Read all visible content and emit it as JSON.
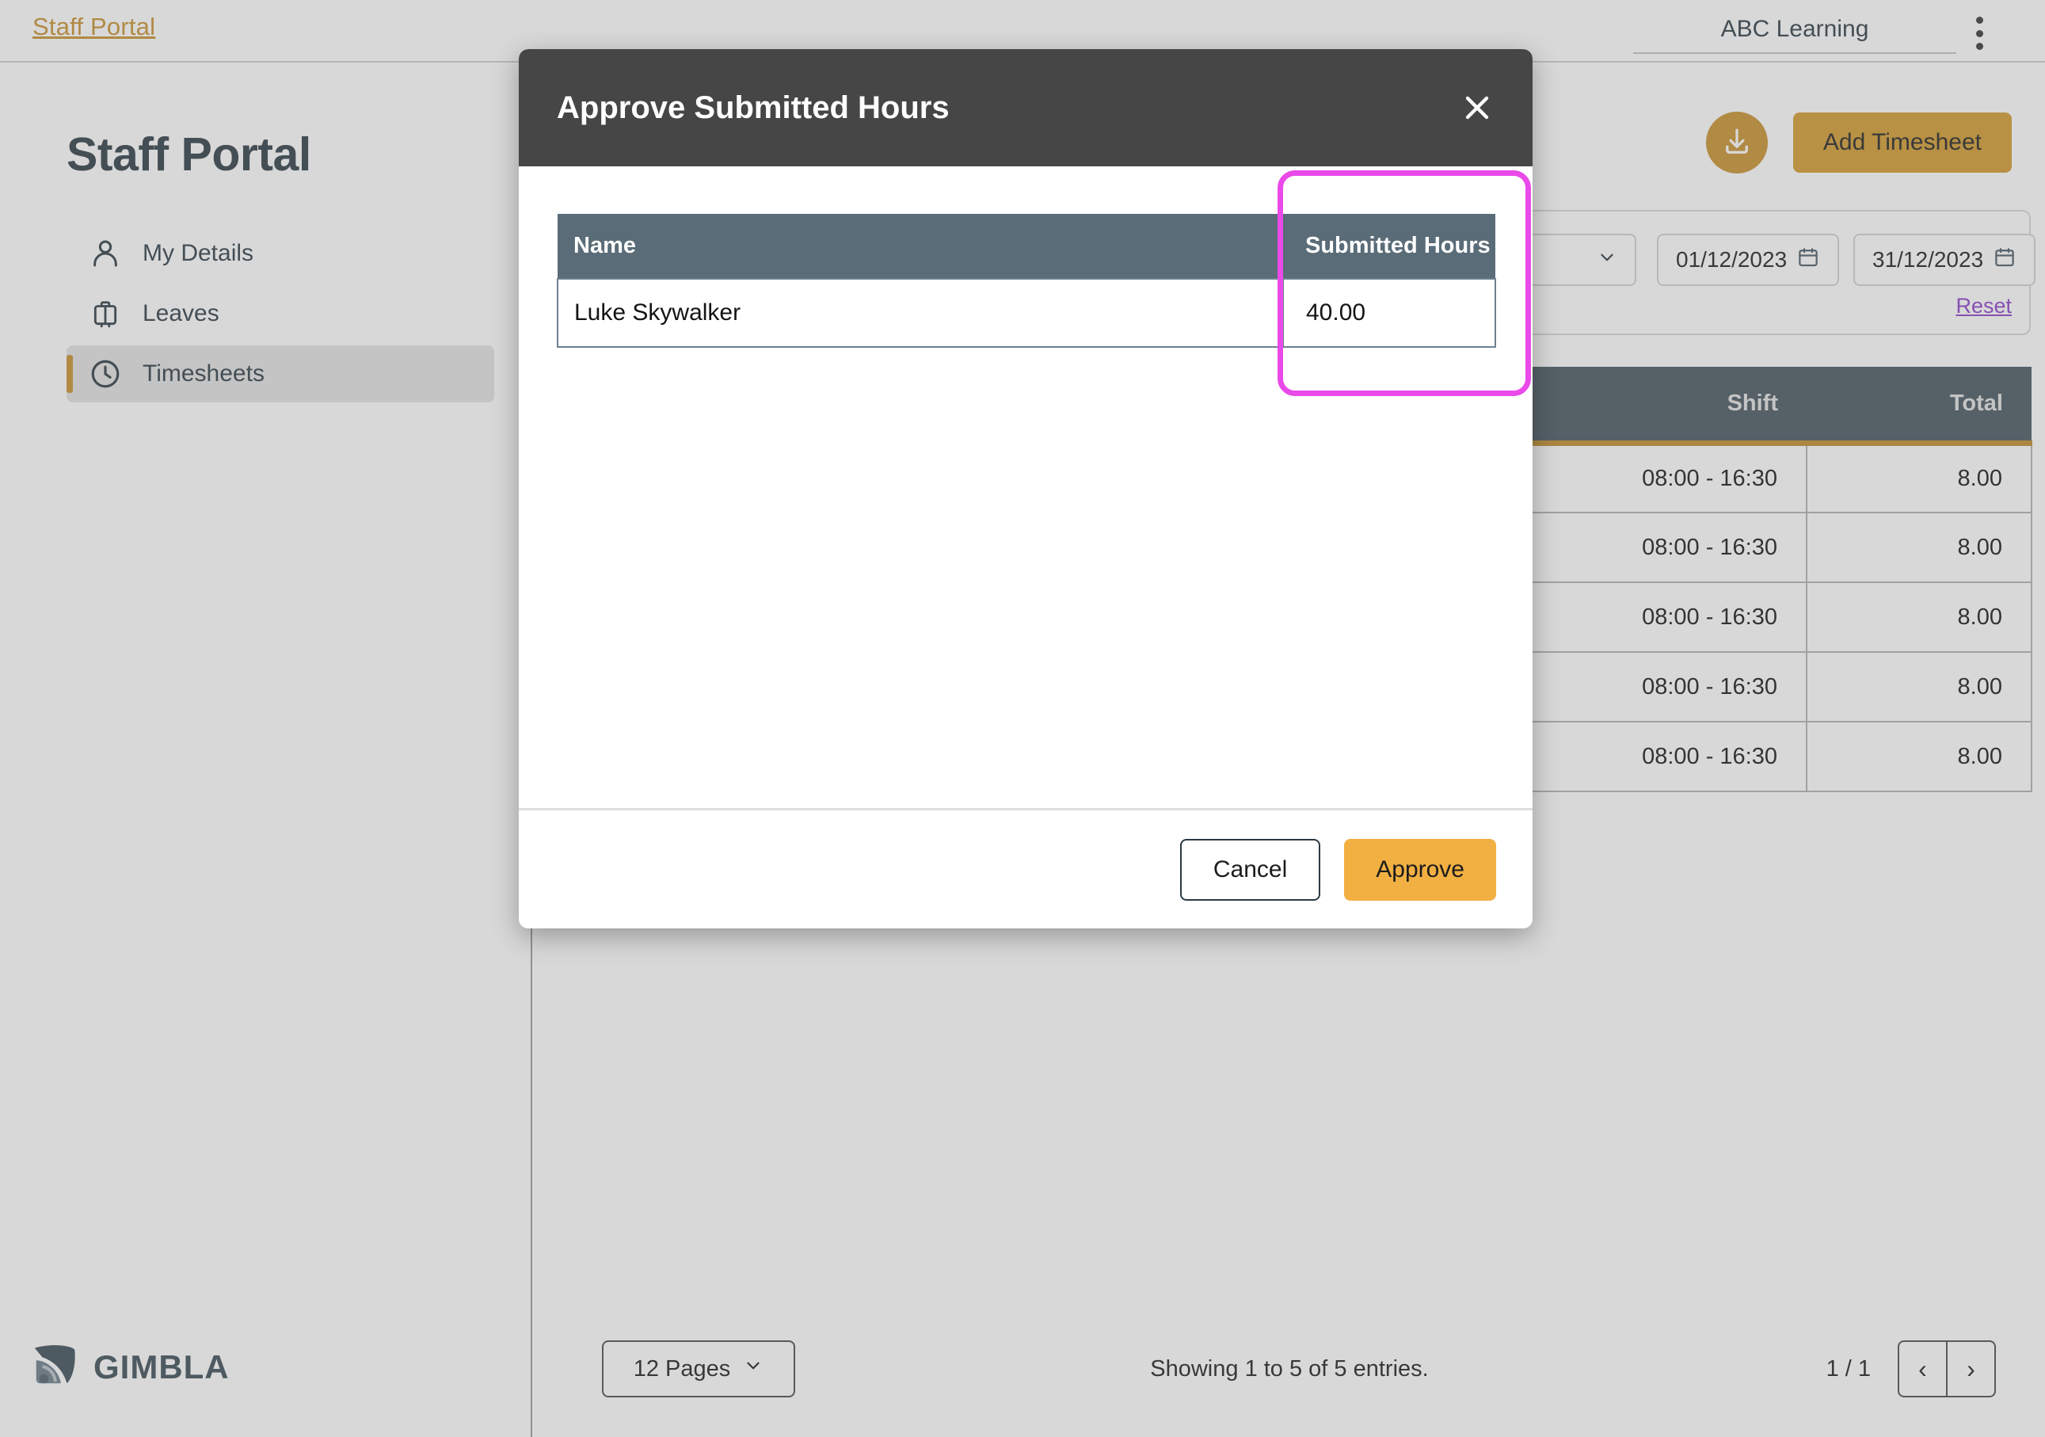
{
  "topbar": {
    "brand": "Staff Portal",
    "org_name": "ABC Learning",
    "kebab_icon": "more-vertical-icon"
  },
  "sidebar": {
    "title": "Staff Portal",
    "items": [
      {
        "label": "My Details",
        "icon": "user-icon",
        "active": false
      },
      {
        "label": "Leaves",
        "icon": "suitcase-icon",
        "active": false
      },
      {
        "label": "Timesheets",
        "icon": "clock-icon",
        "active": true
      }
    ],
    "logo_text": "GIMBLA",
    "logo_icon": "gimbla-signal-icon"
  },
  "main": {
    "download_icon": "download-icon",
    "add_timesheet_label": "Add Timesheet",
    "filters": {
      "select_value": "",
      "select_icon": "chevron-down-icon",
      "date_from": "01/12/2023",
      "date_to": "31/12/2023",
      "calendar_icon": "calendar-icon",
      "reset_label": "Reset"
    },
    "table": {
      "columns": [
        "",
        "Shift",
        "Total"
      ],
      "rows": [
        {
          "blank": "",
          "shift": "08:00 - 16:30",
          "total": "8.00"
        },
        {
          "blank": "",
          "shift": "08:00 - 16:30",
          "total": "8.00"
        },
        {
          "blank": "",
          "shift": "08:00 - 16:30",
          "total": "8.00"
        },
        {
          "blank": "",
          "shift": "08:00 - 16:30",
          "total": "8.00"
        },
        {
          "blank": "",
          "shift": "08:00 - 16:30",
          "total": "8.00"
        }
      ]
    },
    "pager": {
      "pages_label": "12 Pages",
      "pages_icon": "chevron-down-icon",
      "entries_info": "Showing 1 to 5 of 5 entries.",
      "page_indicator": "1 / 1",
      "prev_icon": "chevron-left-icon",
      "next_icon": "chevron-right-icon",
      "prev_glyph": "‹",
      "next_glyph": "›"
    }
  },
  "modal": {
    "title": "Approve Submitted Hours",
    "close_icon": "close-icon",
    "table": {
      "columns": [
        "Name",
        "Submitted Hours"
      ],
      "rows": [
        {
          "name": "Luke Skywalker",
          "submitted_hours": "40.00"
        }
      ]
    },
    "cancel_label": "Cancel",
    "approve_label": "Approve",
    "highlight_color": "#e94ae9",
    "highlight_target": "submitted-hours-column"
  },
  "colors": {
    "brand_gold": "#c8902c",
    "accent_amber": "#d19a2c",
    "approve_amber": "#f2b043",
    "dark_slate": "#2b3a44",
    "table_header": "#44535e",
    "modal_table_header": "#5a6c77",
    "modal_header": "#464646",
    "reset_purple": "#8a3ec9",
    "highlight_pink": "#e94ae9"
  }
}
